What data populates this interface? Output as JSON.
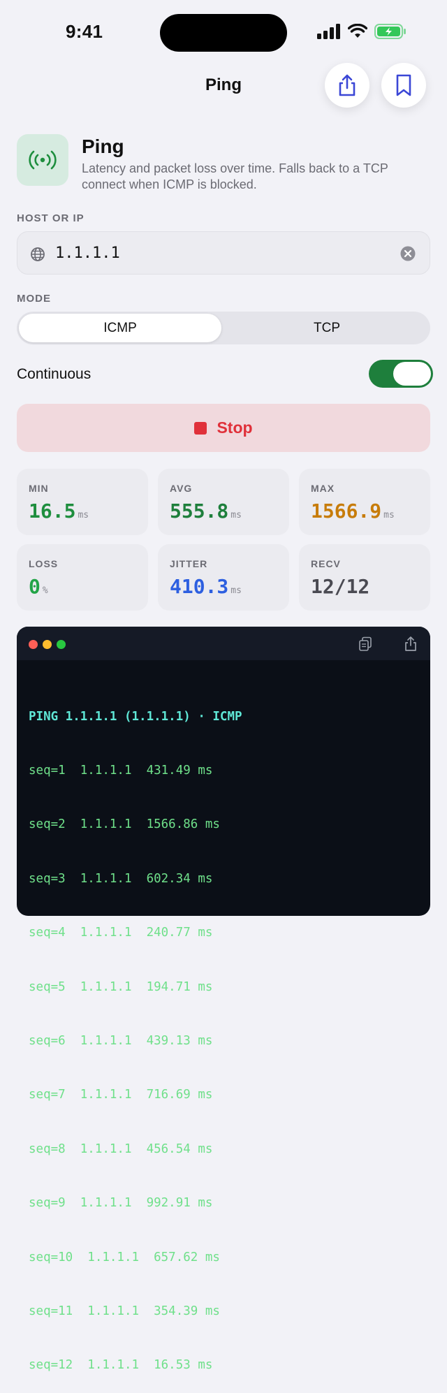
{
  "status_bar": {
    "time": "9:41"
  },
  "nav": {
    "title": "Ping"
  },
  "header": {
    "title": "Ping",
    "subtitle": "Latency and packet loss over time. Falls back to a TCP connect when ICMP is blocked."
  },
  "host": {
    "label": "HOST OR IP",
    "value": "1.1.1.1"
  },
  "mode": {
    "label": "MODE",
    "options": [
      "ICMP",
      "TCP"
    ],
    "selected": "ICMP"
  },
  "continuous": {
    "label": "Continuous",
    "on": true
  },
  "action": {
    "label": "Stop"
  },
  "stats": {
    "min": {
      "label": "MIN",
      "value": "16.5",
      "unit": "ms",
      "color": "#1e8e3e"
    },
    "avg": {
      "label": "AVG",
      "value": "555.8",
      "unit": "ms",
      "color": "#1e7f3c"
    },
    "max": {
      "label": "MAX",
      "value": "1566.9",
      "unit": "ms",
      "color": "#c77c0a"
    },
    "loss": {
      "label": "LOSS",
      "value": "0",
      "unit": "%",
      "color": "#22a447"
    },
    "jitter": {
      "label": "JITTER",
      "value": "410.3",
      "unit": "ms",
      "color": "#2d5fe0"
    },
    "recv": {
      "label": "RECV",
      "value": "12/12",
      "color": "#4a4a52"
    }
  },
  "terminal": {
    "header": "PING 1.1.1.1 (1.1.1.1) · ICMP",
    "lines": [
      "seq=1  1.1.1.1  431.49 ms",
      "seq=2  1.1.1.1  1566.86 ms",
      "seq=3  1.1.1.1  602.34 ms",
      "seq=4  1.1.1.1  240.77 ms",
      "seq=5  1.1.1.1  194.71 ms",
      "seq=6  1.1.1.1  439.13 ms",
      "seq=7  1.1.1.1  716.69 ms",
      "seq=8  1.1.1.1  456.54 ms",
      "seq=9  1.1.1.1  992.91 ms",
      "seq=10  1.1.1.1  657.62 ms",
      "seq=11  1.1.1.1  354.39 ms",
      "seq=12  1.1.1.1  16.53 ms"
    ]
  },
  "icons": {
    "share": "share-icon",
    "bookmark": "bookmark-icon",
    "app": "broadcast-icon",
    "globe": "globe-icon",
    "clear": "clear-icon",
    "copy": "copy-icon"
  }
}
